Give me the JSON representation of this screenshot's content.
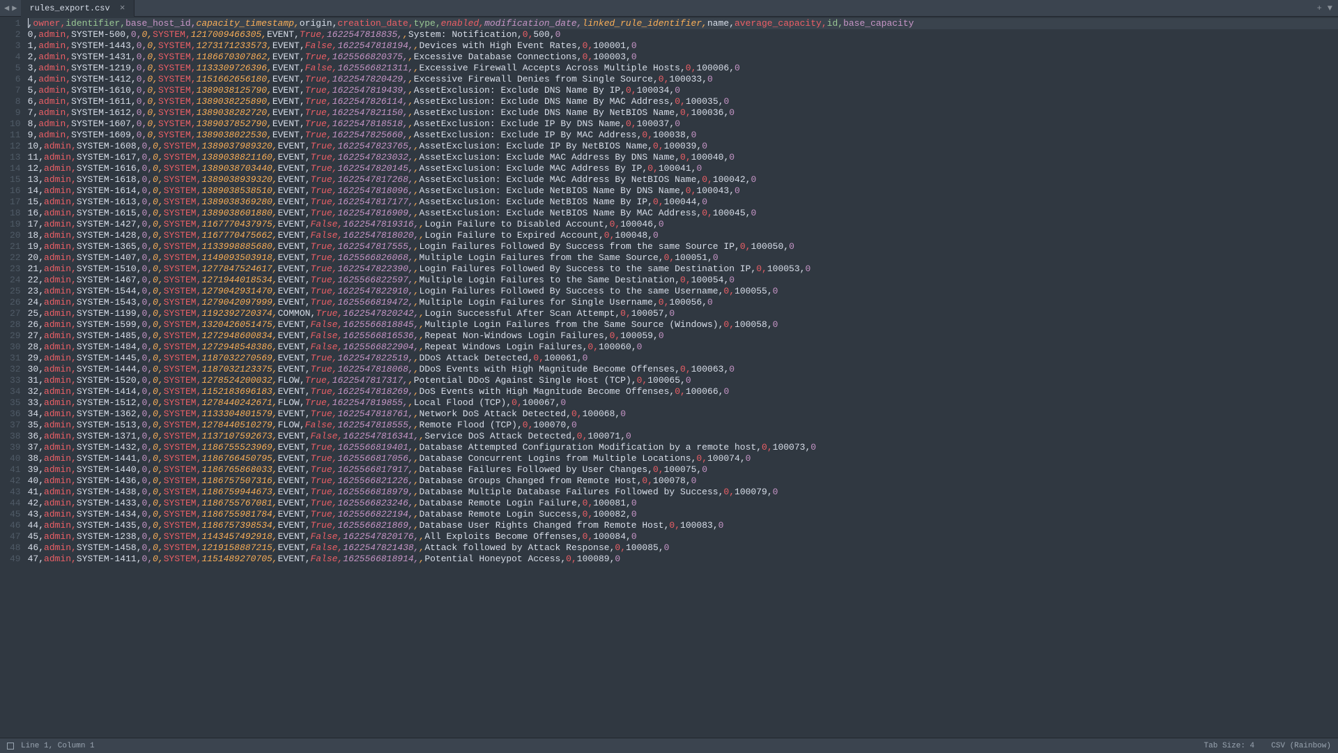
{
  "tab": {
    "filename": "rules_export.csv"
  },
  "status": {
    "position": "Line 1, Column 1",
    "tab_size": "Tab Size: 4",
    "syntax": "CSV (Rainbow)"
  },
  "header": [
    "",
    "owner",
    "identifier",
    "base_host_id",
    "capacity_timestamp",
    "origin",
    "creation_date",
    "type",
    "enabled",
    "modification_date",
    "linked_rule_identifier",
    "name",
    "average_capacity",
    "id",
    "base_capacity"
  ],
  "chart_data": {
    "type": "table",
    "columns": [
      "",
      "owner",
      "identifier",
      "base_host_id",
      "capacity_timestamp",
      "origin",
      "creation_date",
      "type",
      "enabled",
      "modification_date",
      "linked_rule_identifier",
      "name",
      "average_capacity",
      "id",
      "base_capacity"
    ],
    "rows": [
      [
        "0",
        "admin",
        "SYSTEM-500",
        "0",
        "0",
        "SYSTEM",
        "1217009466305",
        "EVENT",
        "True",
        "1622547818835",
        "",
        "System: Notification",
        "0",
        "500",
        "0"
      ],
      [
        "1",
        "admin",
        "SYSTEM-1443",
        "0",
        "0",
        "SYSTEM",
        "1273171233573",
        "EVENT",
        "False",
        "1622547818194",
        "",
        "Devices with High Event Rates",
        "0",
        "100001",
        "0"
      ],
      [
        "2",
        "admin",
        "SYSTEM-1431",
        "0",
        "0",
        "SYSTEM",
        "1186670307862",
        "EVENT",
        "True",
        "1625566820375",
        "",
        "Excessive Database Connections",
        "0",
        "100003",
        "0"
      ],
      [
        "3",
        "admin",
        "SYSTEM-1219",
        "0",
        "0",
        "SYSTEM",
        "1133309726396",
        "EVENT",
        "False",
        "1625566821311",
        "",
        "Excessive Firewall Accepts Across Multiple Hosts",
        "0",
        "100006",
        "0"
      ],
      [
        "4",
        "admin",
        "SYSTEM-1412",
        "0",
        "0",
        "SYSTEM",
        "1151662656180",
        "EVENT",
        "True",
        "1622547820429",
        "",
        "Excessive Firewall Denies from Single Source",
        "0",
        "100033",
        "0"
      ],
      [
        "5",
        "admin",
        "SYSTEM-1610",
        "0",
        "0",
        "SYSTEM",
        "1389038125790",
        "EVENT",
        "True",
        "1622547819439",
        "",
        "AssetExclusion: Exclude DNS Name By IP",
        "0",
        "100034",
        "0"
      ],
      [
        "6",
        "admin",
        "SYSTEM-1611",
        "0",
        "0",
        "SYSTEM",
        "1389038225890",
        "EVENT",
        "True",
        "1622547826114",
        "",
        "AssetExclusion: Exclude DNS Name By MAC Address",
        "0",
        "100035",
        "0"
      ],
      [
        "7",
        "admin",
        "SYSTEM-1612",
        "0",
        "0",
        "SYSTEM",
        "1389038282720",
        "EVENT",
        "True",
        "1622547821150",
        "",
        "AssetExclusion: Exclude DNS Name By NetBIOS Name",
        "0",
        "100036",
        "0"
      ],
      [
        "8",
        "admin",
        "SYSTEM-1607",
        "0",
        "0",
        "SYSTEM",
        "1389037852790",
        "EVENT",
        "True",
        "1622547818518",
        "",
        "AssetExclusion: Exclude IP By DNS Name",
        "0",
        "100037",
        "0"
      ],
      [
        "9",
        "admin",
        "SYSTEM-1609",
        "0",
        "0",
        "SYSTEM",
        "1389038022530",
        "EVENT",
        "True",
        "1622547825660",
        "",
        "AssetExclusion: Exclude IP By MAC Address",
        "0",
        "100038",
        "0"
      ],
      [
        "10",
        "admin",
        "SYSTEM-1608",
        "0",
        "0",
        "SYSTEM",
        "1389037989320",
        "EVENT",
        "True",
        "1622547823765",
        "",
        "AssetExclusion: Exclude IP By NetBIOS Name",
        "0",
        "100039",
        "0"
      ],
      [
        "11",
        "admin",
        "SYSTEM-1617",
        "0",
        "0",
        "SYSTEM",
        "1389038821160",
        "EVENT",
        "True",
        "1622547823032",
        "",
        "AssetExclusion: Exclude MAC Address By DNS Name",
        "0",
        "100040",
        "0"
      ],
      [
        "12",
        "admin",
        "SYSTEM-1616",
        "0",
        "0",
        "SYSTEM",
        "1389038703440",
        "EVENT",
        "True",
        "1622547820145",
        "",
        "AssetExclusion: Exclude MAC Address By IP",
        "0",
        "100041",
        "0"
      ],
      [
        "13",
        "admin",
        "SYSTEM-1618",
        "0",
        "0",
        "SYSTEM",
        "1389038939320",
        "EVENT",
        "True",
        "1622547817268",
        "",
        "AssetExclusion: Exclude MAC Address By NetBIOS Name",
        "0",
        "100042",
        "0"
      ],
      [
        "14",
        "admin",
        "SYSTEM-1614",
        "0",
        "0",
        "SYSTEM",
        "1389038538510",
        "EVENT",
        "True",
        "1622547818096",
        "",
        "AssetExclusion: Exclude NetBIOS Name By DNS Name",
        "0",
        "100043",
        "0"
      ],
      [
        "15",
        "admin",
        "SYSTEM-1613",
        "0",
        "0",
        "SYSTEM",
        "1389038369280",
        "EVENT",
        "True",
        "1622547817177",
        "",
        "AssetExclusion: Exclude NetBIOS Name By IP",
        "0",
        "100044",
        "0"
      ],
      [
        "16",
        "admin",
        "SYSTEM-1615",
        "0",
        "0",
        "SYSTEM",
        "1389038601880",
        "EVENT",
        "True",
        "1622547816909",
        "",
        "AssetExclusion: Exclude NetBIOS Name By MAC Address",
        "0",
        "100045",
        "0"
      ],
      [
        "17",
        "admin",
        "SYSTEM-1427",
        "0",
        "0",
        "SYSTEM",
        "1167770437975",
        "EVENT",
        "False",
        "1622547819316",
        "",
        "Login Failure to Disabled Account",
        "0",
        "100046",
        "0"
      ],
      [
        "18",
        "admin",
        "SYSTEM-1428",
        "0",
        "0",
        "SYSTEM",
        "1167770475662",
        "EVENT",
        "False",
        "1622547818020",
        "",
        "Login Failure to Expired Account",
        "0",
        "100048",
        "0"
      ],
      [
        "19",
        "admin",
        "SYSTEM-1365",
        "0",
        "0",
        "SYSTEM",
        "1133998885680",
        "EVENT",
        "True",
        "1622547817555",
        "",
        "Login Failures Followed By Success from the same Source IP",
        "0",
        "100050",
        "0"
      ],
      [
        "20",
        "admin",
        "SYSTEM-1407",
        "0",
        "0",
        "SYSTEM",
        "1149093503918",
        "EVENT",
        "True",
        "1625566826068",
        "",
        "Multiple Login Failures from the Same Source",
        "0",
        "100051",
        "0"
      ],
      [
        "21",
        "admin",
        "SYSTEM-1510",
        "0",
        "0",
        "SYSTEM",
        "1277847524617",
        "EVENT",
        "True",
        "1622547822390",
        "",
        "Login Failures Followed By Success to the same Destination IP",
        "0",
        "100053",
        "0"
      ],
      [
        "22",
        "admin",
        "SYSTEM-1467",
        "0",
        "0",
        "SYSTEM",
        "1271944018534",
        "EVENT",
        "True",
        "1625566822597",
        "",
        "Multiple Login Failures to the Same Destination",
        "0",
        "100054",
        "0"
      ],
      [
        "23",
        "admin",
        "SYSTEM-1544",
        "0",
        "0",
        "SYSTEM",
        "1279042931470",
        "EVENT",
        "True",
        "1622547822910",
        "",
        "Login Failures Followed By Success to the same Username",
        "0",
        "100055",
        "0"
      ],
      [
        "24",
        "admin",
        "SYSTEM-1543",
        "0",
        "0",
        "SYSTEM",
        "1279042097999",
        "EVENT",
        "True",
        "1625566819472",
        "",
        "Multiple Login Failures for Single Username",
        "0",
        "100056",
        "0"
      ],
      [
        "25",
        "admin",
        "SYSTEM-1199",
        "0",
        "0",
        "SYSTEM",
        "1192392720374",
        "COMMON",
        "True",
        "1622547820242",
        "",
        "Login Successful After Scan Attempt",
        "0",
        "100057",
        "0"
      ],
      [
        "26",
        "admin",
        "SYSTEM-1599",
        "0",
        "0",
        "SYSTEM",
        "1320426051475",
        "EVENT",
        "False",
        "1625566818845",
        "",
        "Multiple Login Failures from the Same Source (Windows)",
        "0",
        "100058",
        "0"
      ],
      [
        "27",
        "admin",
        "SYSTEM-1485",
        "0",
        "0",
        "SYSTEM",
        "1272948600834",
        "EVENT",
        "False",
        "1625566816536",
        "",
        "Repeat Non-Windows Login Failures",
        "0",
        "100059",
        "0"
      ],
      [
        "28",
        "admin",
        "SYSTEM-1484",
        "0",
        "0",
        "SYSTEM",
        "1272948548386",
        "EVENT",
        "False",
        "1625566822904",
        "",
        "Repeat Windows Login Failures",
        "0",
        "100060",
        "0"
      ],
      [
        "29",
        "admin",
        "SYSTEM-1445",
        "0",
        "0",
        "SYSTEM",
        "1187032270569",
        "EVENT",
        "True",
        "1622547822519",
        "",
        "DDoS Attack Detected",
        "0",
        "100061",
        "0"
      ],
      [
        "30",
        "admin",
        "SYSTEM-1444",
        "0",
        "0",
        "SYSTEM",
        "1187032123375",
        "EVENT",
        "True",
        "1622547818068",
        "",
        "DDoS Events with High Magnitude Become Offenses",
        "0",
        "100063",
        "0"
      ],
      [
        "31",
        "admin",
        "SYSTEM-1520",
        "0",
        "0",
        "SYSTEM",
        "1278524200032",
        "FLOW",
        "True",
        "1622547817317",
        "",
        "Potential DDoS Against Single Host (TCP)",
        "0",
        "100065",
        "0"
      ],
      [
        "32",
        "admin",
        "SYSTEM-1414",
        "0",
        "0",
        "SYSTEM",
        "1152183696183",
        "EVENT",
        "True",
        "1622547818269",
        "",
        "DoS Events with High Magnitude Become Offenses",
        "0",
        "100066",
        "0"
      ],
      [
        "33",
        "admin",
        "SYSTEM-1512",
        "0",
        "0",
        "SYSTEM",
        "1278440242671",
        "FLOW",
        "True",
        "1622547819855",
        "",
        "Local Flood (TCP)",
        "0",
        "100067",
        "0"
      ],
      [
        "34",
        "admin",
        "SYSTEM-1362",
        "0",
        "0",
        "SYSTEM",
        "1133304801579",
        "EVENT",
        "True",
        "1622547818761",
        "",
        "Network DoS Attack Detected",
        "0",
        "100068",
        "0"
      ],
      [
        "35",
        "admin",
        "SYSTEM-1513",
        "0",
        "0",
        "SYSTEM",
        "1278440510279",
        "FLOW",
        "False",
        "1622547818555",
        "",
        "Remote Flood (TCP)",
        "0",
        "100070",
        "0"
      ],
      [
        "36",
        "admin",
        "SYSTEM-1371",
        "0",
        "0",
        "SYSTEM",
        "1137107592673",
        "EVENT",
        "False",
        "1622547816341",
        "",
        "Service DoS Attack Detected",
        "0",
        "100071",
        "0"
      ],
      [
        "37",
        "admin",
        "SYSTEM-1432",
        "0",
        "0",
        "SYSTEM",
        "1186755523969",
        "EVENT",
        "True",
        "1625566819401",
        "",
        "Database Attempted Configuration Modification by a remote host",
        "0",
        "100073",
        "0"
      ],
      [
        "38",
        "admin",
        "SYSTEM-1441",
        "0",
        "0",
        "SYSTEM",
        "1186766450795",
        "EVENT",
        "True",
        "1625566817056",
        "",
        "Database Concurrent Logins from Multiple Locations",
        "0",
        "100074",
        "0"
      ],
      [
        "39",
        "admin",
        "SYSTEM-1440",
        "0",
        "0",
        "SYSTEM",
        "1186765868033",
        "EVENT",
        "True",
        "1625566817917",
        "",
        "Database Failures Followed by User Changes",
        "0",
        "100075",
        "0"
      ],
      [
        "40",
        "admin",
        "SYSTEM-1436",
        "0",
        "0",
        "SYSTEM",
        "1186757507316",
        "EVENT",
        "True",
        "1625566821226",
        "",
        "Database Groups Changed from Remote Host",
        "0",
        "100078",
        "0"
      ],
      [
        "41",
        "admin",
        "SYSTEM-1438",
        "0",
        "0",
        "SYSTEM",
        "1186759944673",
        "EVENT",
        "True",
        "1625566818979",
        "",
        "Database Multiple Database Failures Followed by Success",
        "0",
        "100079",
        "0"
      ],
      [
        "42",
        "admin",
        "SYSTEM-1433",
        "0",
        "0",
        "SYSTEM",
        "1186755767081",
        "EVENT",
        "True",
        "1625566823246",
        "",
        "Database Remote Login Failure",
        "0",
        "100081",
        "0"
      ],
      [
        "43",
        "admin",
        "SYSTEM-1434",
        "0",
        "0",
        "SYSTEM",
        "1186755981784",
        "EVENT",
        "True",
        "1625566822194",
        "",
        "Database Remote Login Success",
        "0",
        "100082",
        "0"
      ],
      [
        "44",
        "admin",
        "SYSTEM-1435",
        "0",
        "0",
        "SYSTEM",
        "1186757398534",
        "EVENT",
        "True",
        "1625566821869",
        "",
        "Database User Rights Changed from Remote Host",
        "0",
        "100083",
        "0"
      ],
      [
        "45",
        "admin",
        "SYSTEM-1238",
        "0",
        "0",
        "SYSTEM",
        "1143457492918",
        "EVENT",
        "False",
        "1622547820176",
        "",
        "All Exploits Become Offenses",
        "0",
        "100084",
        "0"
      ],
      [
        "46",
        "admin",
        "SYSTEM-1458",
        "0",
        "0",
        "SYSTEM",
        "1219158887215",
        "EVENT",
        "False",
        "1622547821438",
        "",
        "Attack followed by Attack Response",
        "0",
        "100085",
        "0"
      ],
      [
        "47",
        "admin",
        "SYSTEM-1411",
        "0",
        "0",
        "SYSTEM",
        "1151489270705",
        "EVENT",
        "False",
        "1625566818914",
        "",
        "Potential Honeypot Access",
        "0",
        "100089",
        "0"
      ]
    ]
  }
}
